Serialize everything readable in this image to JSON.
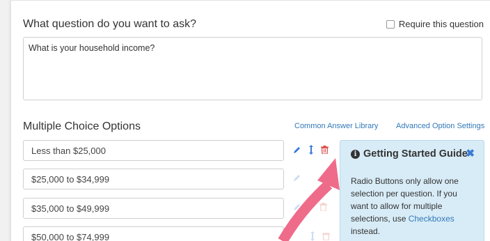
{
  "question": {
    "heading": "What question do you want to ask?",
    "require_label": "Require this question",
    "text": "What is your household income?"
  },
  "options_section": {
    "heading": "Multiple Choice Options",
    "common_library_link": "Common Answer Library",
    "advanced_settings_link": "Advanced Option Settings",
    "options": [
      "Less than $25,000",
      "$25,000 to $34,999",
      "$35,000 to $49,999",
      "$50,000 to $74,999"
    ]
  },
  "guide": {
    "title": "Getting Started Guide",
    "body_text": "Radio Buttons only allow one selection per question. If you want to allow for multiple selections, use ",
    "link_text": "Checkboxes",
    "body_end": " instead."
  },
  "icons": {
    "edit": "pencil-icon",
    "reorder": "move-vertical-icon",
    "delete": "trash-icon",
    "info": "info-circle-icon",
    "close": "close-icon"
  },
  "colors": {
    "link": "#3178b8",
    "guide_bg": "#d8ecf7",
    "arrow": "#ef6b8a",
    "delete": "#d9534f"
  }
}
